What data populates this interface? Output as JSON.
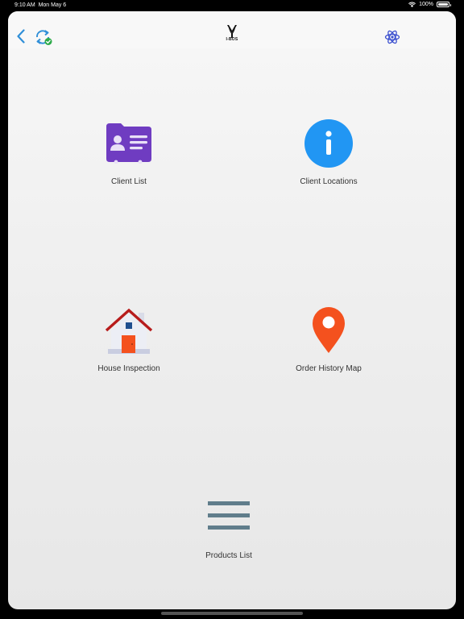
{
  "status_bar": {
    "time": "9:10 AM",
    "date": "Mon May 6",
    "battery": "100%",
    "battery_level": 1.0
  },
  "nav": {
    "back_icon": "chevron-left-icon",
    "sync_icon": "sync-check-icon",
    "logo_text": "I-BOS",
    "settings_icon": "atom-icon"
  },
  "tiles": [
    {
      "label": "Client List",
      "icon": "client-card-icon",
      "color": "#6f3cc1"
    },
    {
      "label": "Client Locations",
      "icon": "info-circle-icon",
      "color": "#2196f3"
    },
    {
      "label": "House Inspection",
      "icon": "house-icon",
      "color": "#b71c1c"
    },
    {
      "label": "Order History Map",
      "icon": "map-pin-icon",
      "color": "#f4511e"
    },
    {
      "label": "Products List",
      "icon": "list-icon",
      "color": "#607d8b"
    }
  ],
  "colors": {
    "accent": "#2f8fd8",
    "sync_check": "#2eaa4a"
  }
}
